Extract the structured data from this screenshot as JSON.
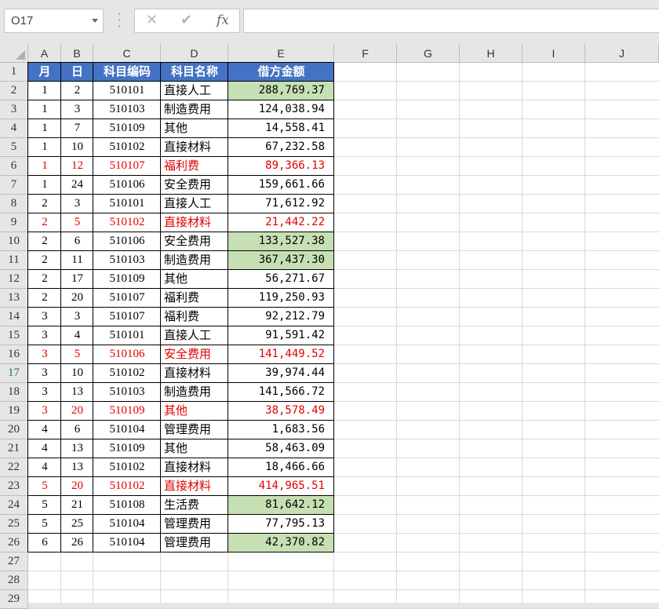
{
  "name_box": {
    "value": "O17"
  },
  "formula_bar": {
    "cancel_icon": "✕",
    "enter_icon": "✔",
    "fx_label": "fx",
    "content": ""
  },
  "columns": [
    "A",
    "B",
    "C",
    "D",
    "E",
    "F",
    "G",
    "H",
    "I",
    "J"
  ],
  "rows": [
    "1",
    "2",
    "3",
    "4",
    "5",
    "6",
    "7",
    "8",
    "9",
    "10",
    "11",
    "12",
    "13",
    "14",
    "15",
    "16",
    "17",
    "18",
    "19",
    "20",
    "21",
    "22",
    "23",
    "24",
    "25",
    "26",
    "27",
    "28",
    "29"
  ],
  "selected_row": "17",
  "headers": [
    "月",
    "日",
    "科目编码",
    "科目名称",
    "借方金额"
  ],
  "data": [
    {
      "m": "1",
      "d": "2",
      "code": "510101",
      "name": "直接人工",
      "amt": "288,769.37",
      "red": false,
      "green": true
    },
    {
      "m": "1",
      "d": "3",
      "code": "510103",
      "name": "制造费用",
      "amt": "124,038.94",
      "red": false,
      "green": false
    },
    {
      "m": "1",
      "d": "7",
      "code": "510109",
      "name": "其他",
      "amt": "14,558.41",
      "red": false,
      "green": false
    },
    {
      "m": "1",
      "d": "10",
      "code": "510102",
      "name": "直接材料",
      "amt": "67,232.58",
      "red": false,
      "green": false
    },
    {
      "m": "1",
      "d": "12",
      "code": "510107",
      "name": "福利费",
      "amt": "89,366.13",
      "red": true,
      "green": false
    },
    {
      "m": "1",
      "d": "24",
      "code": "510106",
      "name": "安全费用",
      "amt": "159,661.66",
      "red": false,
      "green": false
    },
    {
      "m": "2",
      "d": "3",
      "code": "510101",
      "name": "直接人工",
      "amt": "71,612.92",
      "red": false,
      "green": false
    },
    {
      "m": "2",
      "d": "5",
      "code": "510102",
      "name": "直接材料",
      "amt": "21,442.22",
      "red": true,
      "green": false
    },
    {
      "m": "2",
      "d": "6",
      "code": "510106",
      "name": "安全费用",
      "amt": "133,527.38",
      "red": false,
      "green": true
    },
    {
      "m": "2",
      "d": "11",
      "code": "510103",
      "name": "制造费用",
      "amt": "367,437.30",
      "red": false,
      "green": true
    },
    {
      "m": "2",
      "d": "17",
      "code": "510109",
      "name": "其他",
      "amt": "56,271.67",
      "red": false,
      "green": false
    },
    {
      "m": "2",
      "d": "20",
      "code": "510107",
      "name": "福利费",
      "amt": "119,250.93",
      "red": false,
      "green": false
    },
    {
      "m": "3",
      "d": "3",
      "code": "510107",
      "name": "福利费",
      "amt": "92,212.79",
      "red": false,
      "green": false
    },
    {
      "m": "3",
      "d": "4",
      "code": "510101",
      "name": "直接人工",
      "amt": "91,591.42",
      "red": false,
      "green": false
    },
    {
      "m": "3",
      "d": "5",
      "code": "510106",
      "name": "安全费用",
      "amt": "141,449.52",
      "red": true,
      "green": false
    },
    {
      "m": "3",
      "d": "10",
      "code": "510102",
      "name": "直接材料",
      "amt": "39,974.44",
      "red": false,
      "green": false
    },
    {
      "m": "3",
      "d": "13",
      "code": "510103",
      "name": "制造费用",
      "amt": "141,566.72",
      "red": false,
      "green": false
    },
    {
      "m": "3",
      "d": "20",
      "code": "510109",
      "name": "其他",
      "amt": "38,578.49",
      "red": true,
      "green": false
    },
    {
      "m": "4",
      "d": "6",
      "code": "510104",
      "name": "管理费用",
      "amt": "1,683.56",
      "red": false,
      "green": false
    },
    {
      "m": "4",
      "d": "13",
      "code": "510109",
      "name": "其他",
      "amt": "58,463.09",
      "red": false,
      "green": false
    },
    {
      "m": "4",
      "d": "13",
      "code": "510102",
      "name": "直接材料",
      "amt": "18,466.66",
      "red": false,
      "green": false
    },
    {
      "m": "5",
      "d": "20",
      "code": "510102",
      "name": "直接材料",
      "amt": "414,965.51",
      "red": true,
      "green": false
    },
    {
      "m": "5",
      "d": "21",
      "code": "510108",
      "name": "生活费",
      "amt": "81,642.12",
      "red": false,
      "green": true
    },
    {
      "m": "5",
      "d": "25",
      "code": "510104",
      "name": "管理费用",
      "amt": "77,795.13",
      "red": false,
      "green": false
    },
    {
      "m": "6",
      "d": "26",
      "code": "510104",
      "name": "管理费用",
      "amt": "42,370.82",
      "red": false,
      "green": true
    }
  ],
  "colors": {
    "header_fill": "#4472c4",
    "highlight_fill": "#c6e0b4",
    "red_text": "#e00000"
  }
}
